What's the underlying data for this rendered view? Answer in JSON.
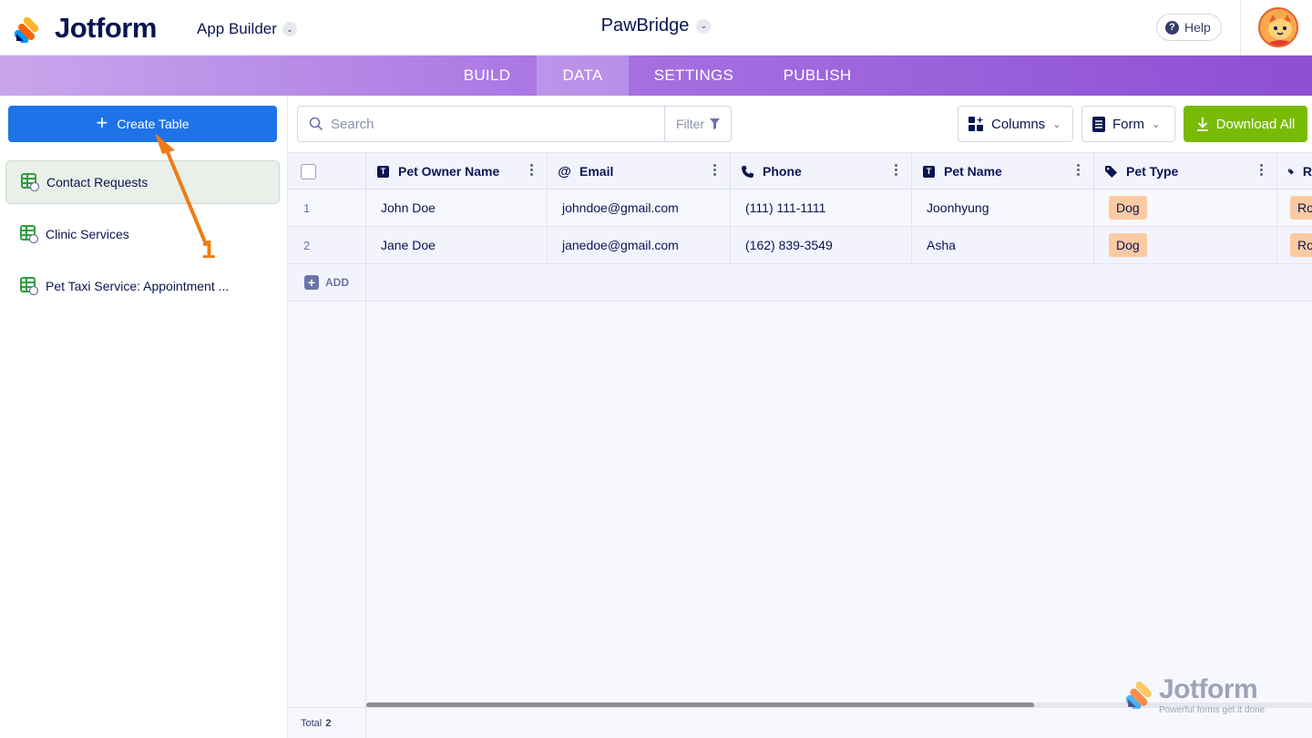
{
  "header": {
    "brand": "Jotform",
    "section": "App Builder",
    "app_name": "PawBridge",
    "help_label": "Help"
  },
  "tabs": [
    {
      "label": "BUILD",
      "active": false
    },
    {
      "label": "DATA",
      "active": true
    },
    {
      "label": "SETTINGS",
      "active": false
    },
    {
      "label": "PUBLISH",
      "active": false
    }
  ],
  "sidebar": {
    "create_label": "Create Table",
    "items": [
      {
        "label": "Contact Requests",
        "active": true
      },
      {
        "label": "Clinic Services",
        "active": false
      },
      {
        "label": "Pet Taxi Service: Appointment ...",
        "active": false
      }
    ]
  },
  "toolbar": {
    "search_placeholder": "Search",
    "filter_label": "Filter",
    "columns_label": "Columns",
    "form_label": "Form",
    "download_label": "Download All"
  },
  "table": {
    "columns": [
      {
        "label": "Pet Owner Name",
        "icon": "text-icon"
      },
      {
        "label": "Email",
        "icon": "at-icon"
      },
      {
        "label": "Phone",
        "icon": "phone-icon"
      },
      {
        "label": "Pet Name",
        "icon": "text-icon"
      },
      {
        "label": "Pet Type",
        "icon": "tag-icon"
      },
      {
        "label": "R",
        "icon": "tag-icon"
      }
    ],
    "rows": [
      {
        "num": "1",
        "owner": "John Doe",
        "email": "johndoe@gmail.com",
        "phone": "(111) 111-1111",
        "pet": "Joonhyung",
        "type": "Dog",
        "extra": "Ro"
      },
      {
        "num": "2",
        "owner": "Jane Doe",
        "email": "janedoe@gmail.com",
        "phone": "(162) 839-3549",
        "pet": "Asha",
        "type": "Dog",
        "extra": "Ro"
      }
    ],
    "add_label": "ADD",
    "total_label": "Total",
    "total_value": "2"
  },
  "watermark": {
    "brand": "Jotform",
    "tagline": "Powerful forms get it done"
  },
  "annotation": {
    "step": "1"
  },
  "colors": {
    "primary": "#1e73e8",
    "download": "#78bb07",
    "tag": "#fbcaa3",
    "annotation": "#f07b12"
  }
}
